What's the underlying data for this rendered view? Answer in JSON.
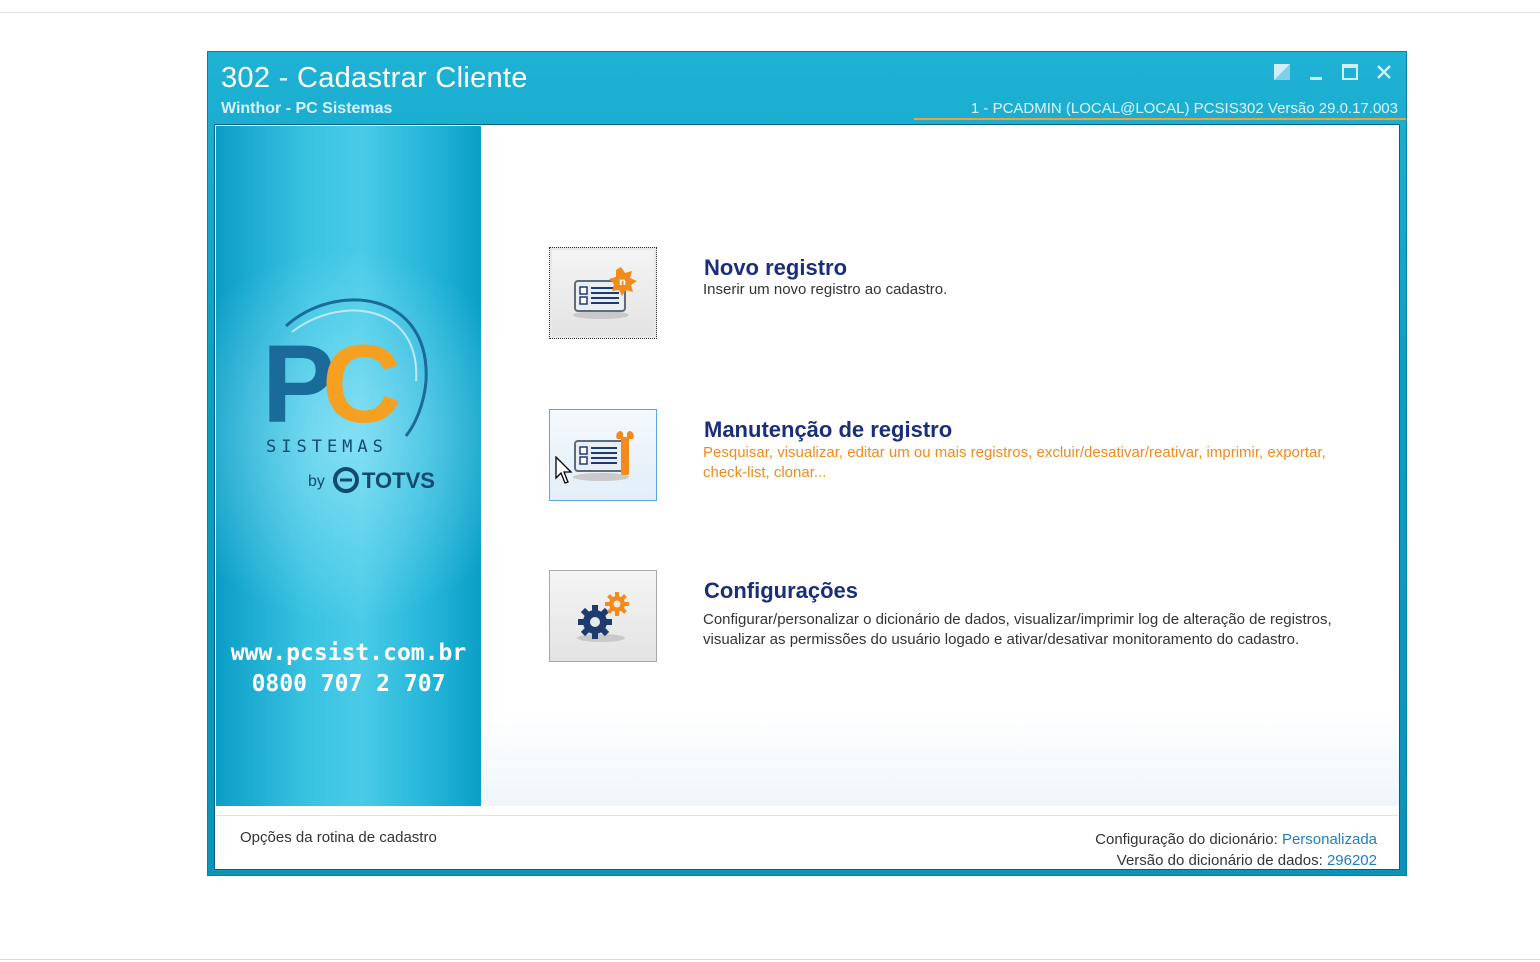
{
  "window": {
    "title": "302 - Cadastrar Cliente",
    "subtitle": "Winthor - PC Sistemas",
    "info": "1 - PCADMIN (LOCAL@LOCAL)   PCSIS302  Versão  29.0.17.003"
  },
  "left_panel": {
    "logo_text": "PC",
    "logo_sub": "SISTEMAS",
    "logo_by": "by",
    "logo_brand": "TOTVS",
    "url": "www.pcsist.com.br",
    "phone": "0800 707 2 707"
  },
  "options": [
    {
      "title": "Novo registro",
      "description": "Inserir um novo registro ao cadastro.",
      "icon": "new-record-icon"
    },
    {
      "title": "Manutenção de registro",
      "description": "Pesquisar, visualizar, editar um ou mais registros, excluir/desativar/reativar, imprimir, exportar, check-list,  clonar...",
      "icon": "maintenance-icon"
    },
    {
      "title": "Configurações",
      "description": "Configurar/personalizar o dicionário de dados, visualizar/imprimir log de alteração de registros, visualizar as permissões do usuário logado e ativar/desativar monitoramento do cadastro.",
      "icon": "gears-icon"
    }
  ],
  "footer": {
    "left": "Opções da rotina de cadastro",
    "dict_config_label": "Configuração do dicionário:",
    "dict_config_value": "Personalizada",
    "dict_version_label": "Versão do dicionário de dados:",
    "dict_version_value": "296202"
  },
  "colors": {
    "title_bar": "#0b9fc6",
    "option_title": "#1a2f7a",
    "highlight_orange": "#f08a1c",
    "footer_value": "#1f7ec0"
  }
}
